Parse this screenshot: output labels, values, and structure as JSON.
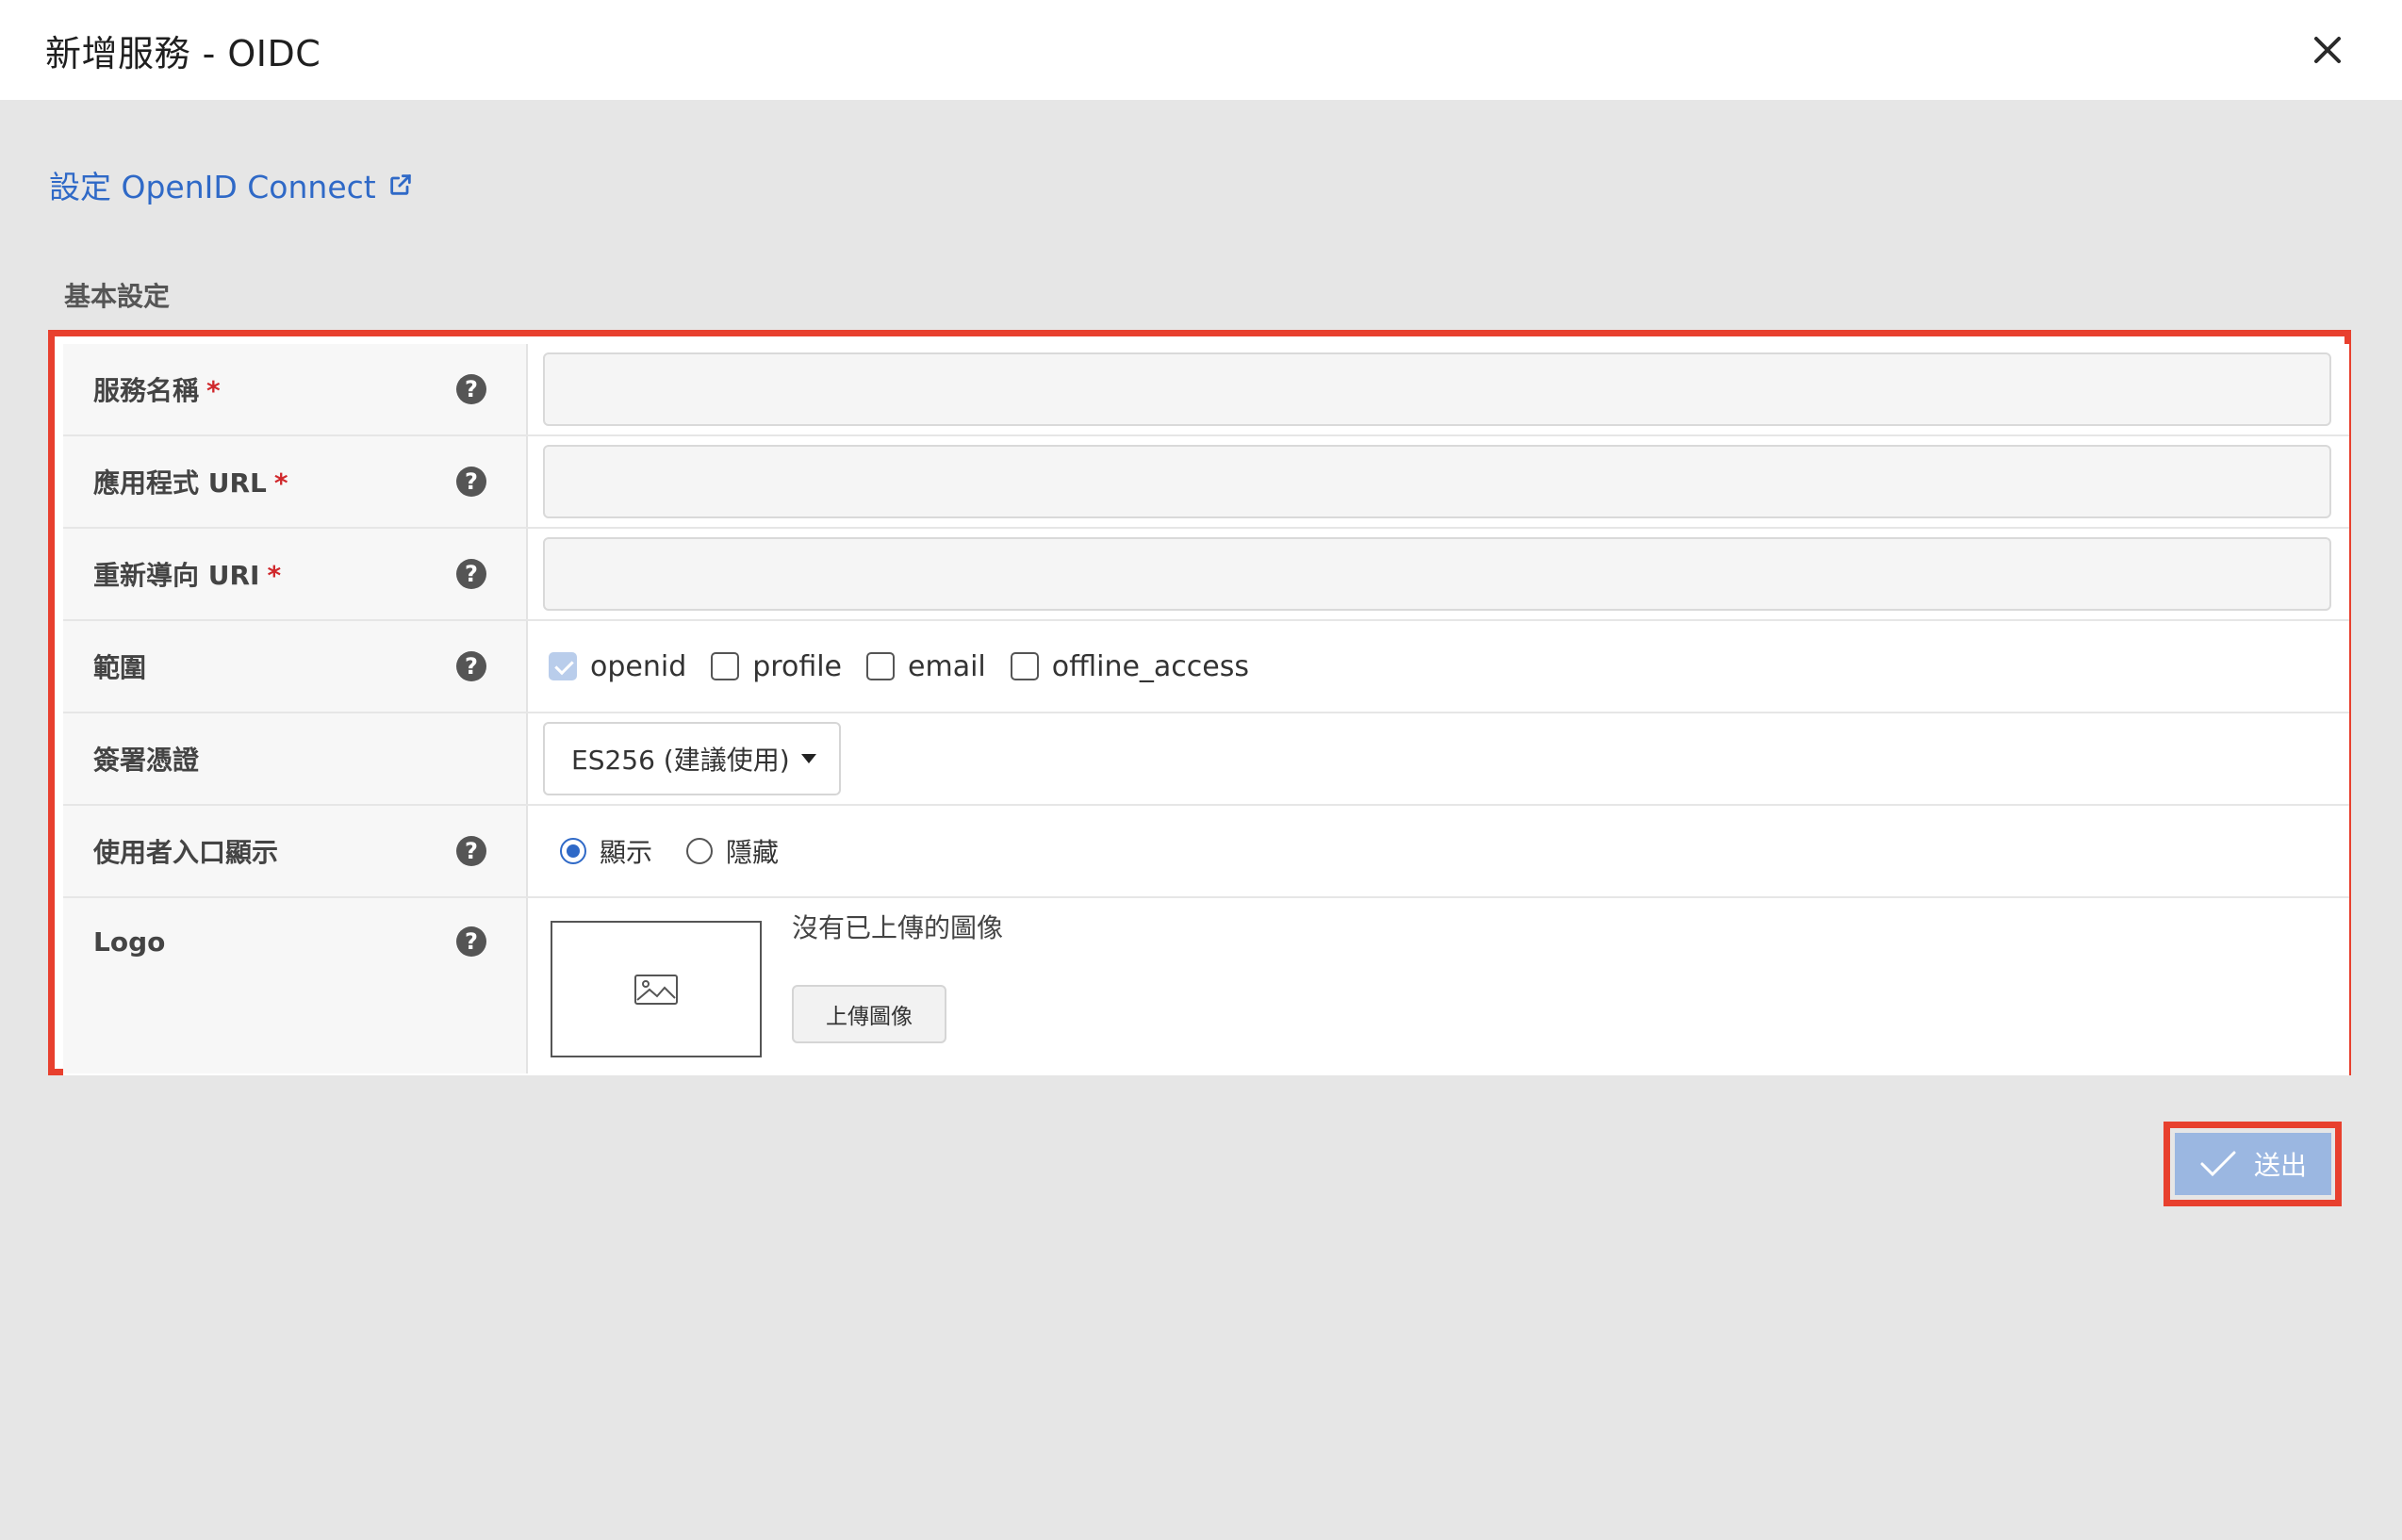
{
  "dialog": {
    "title": "新增服務 - OIDC",
    "close_icon": "close-icon"
  },
  "doc_link": {
    "label": "設定 OpenID Connect",
    "icon": "external-link-icon"
  },
  "section": {
    "label": "基本設定"
  },
  "fields": {
    "service_name": {
      "label": "服務名稱",
      "required_mark": "*",
      "value": ""
    },
    "app_url": {
      "label": "應用程式 URL",
      "required_mark": "*",
      "value": ""
    },
    "redirect_uri": {
      "label": "重新導向 URI",
      "required_mark": "*",
      "value": ""
    },
    "scope": {
      "label": "範圍",
      "options": [
        {
          "label": "openid",
          "checked": true,
          "disabled": true
        },
        {
          "label": "profile",
          "checked": false
        },
        {
          "label": "email",
          "checked": false
        },
        {
          "label": "offline_access",
          "checked": false
        }
      ]
    },
    "signing_cert": {
      "label": "簽署憑證",
      "selected": "ES256 (建議使用)"
    },
    "portal_display": {
      "label": "使用者入口顯示",
      "options": [
        {
          "label": "顯示",
          "selected": true
        },
        {
          "label": "隱藏",
          "selected": false
        }
      ]
    },
    "logo": {
      "label": "Logo",
      "status": "沒有已上傳的圖像",
      "upload_label": "上傳圖像",
      "placeholder_icon": "image-icon"
    }
  },
  "help_icon": "question-circle-icon",
  "submit": {
    "label": "送出",
    "icon": "check-icon"
  },
  "colors": {
    "link": "#2f69c7",
    "highlight": "#e8402e",
    "submit_bg": "#9bb7e1",
    "required": "#d0282c"
  }
}
